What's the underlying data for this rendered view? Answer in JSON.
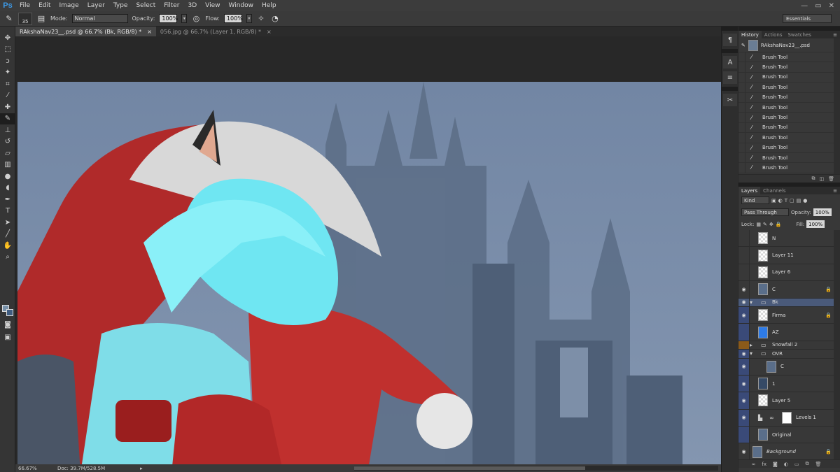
{
  "app": {
    "logo": "Ps"
  },
  "menu": [
    "File",
    "Edit",
    "Image",
    "Layer",
    "Type",
    "Select",
    "Filter",
    "3D",
    "View",
    "Window",
    "Help"
  ],
  "window_controls": {
    "minimize": "—",
    "restore": "▭",
    "close": "✕"
  },
  "options_bar": {
    "brush_size": "35",
    "mode_label": "Mode:",
    "mode_value": "Normal",
    "opacity_label": "Opacity:",
    "opacity_value": "100%",
    "flow_label": "Flow:",
    "flow_value": "100%",
    "workspace": "Essentials"
  },
  "doc_tabs": [
    {
      "label": "RAkshaNav23__.psd @ 66.7% (Bk, RGB/8) *",
      "close": "×",
      "active": true
    },
    {
      "label": "056.jpg @ 66.7% (Layer 1, RGB/8) *",
      "close": "×",
      "active": false
    }
  ],
  "status_bar": {
    "zoom": "66.67%",
    "doc": "Doc: 39.7M/528.5M",
    "arrow": "▸"
  },
  "colors": {
    "foreground": "#7790a8",
    "background": "#3f5c80",
    "accent": "#3d9be9"
  },
  "history_panel": {
    "tabs": [
      "History",
      "Actions",
      "Swatches"
    ],
    "snapshot": "RAkshaNav23__.psd",
    "items": [
      "Brush Tool",
      "Brush Tool",
      "Brush Tool",
      "Brush Tool",
      "Brush Tool",
      "Brush Tool",
      "Brush Tool",
      "Brush Tool",
      "Brush Tool",
      "Brush Tool",
      "Brush Tool",
      "Brush Tool"
    ]
  },
  "layers_panel": {
    "tabs": [
      "Layers",
      "Channels"
    ],
    "filter_kind": "Kind",
    "blend_mode": "Pass Through",
    "opacity_label": "Opacity:",
    "opacity_value": "100%",
    "lock_label": "Lock:",
    "fill_label": "Fill:",
    "fill_value": "100%",
    "layers": [
      {
        "name": "N"
      },
      {
        "name": "Layer 11"
      },
      {
        "name": "Layer 6"
      },
      {
        "name": "C"
      },
      {
        "name": "Bk"
      },
      {
        "name": "Firma"
      },
      {
        "name": "AZ"
      },
      {
        "name": "Snowfall 2"
      },
      {
        "name": "OVR"
      },
      {
        "name": "C"
      },
      {
        "name": "1"
      },
      {
        "name": "Layer 5"
      },
      {
        "name": "Levels 1"
      },
      {
        "name": "Original"
      },
      {
        "name": "Background"
      }
    ]
  }
}
